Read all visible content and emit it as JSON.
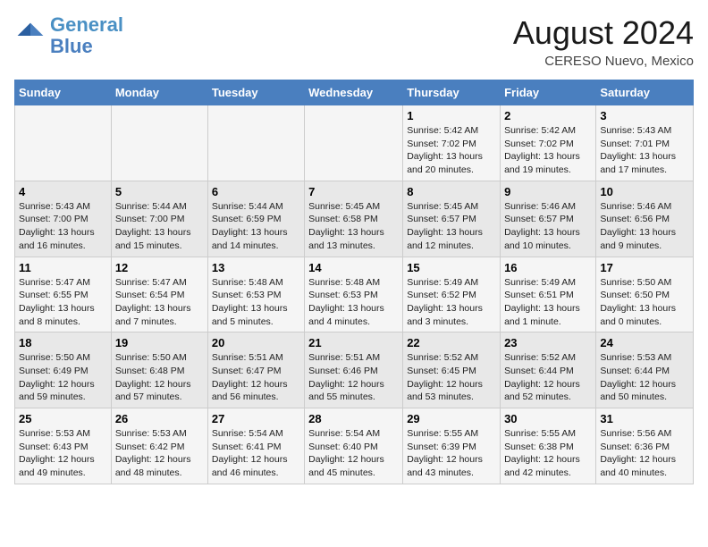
{
  "header": {
    "logo_line1": "General",
    "logo_line2": "Blue",
    "month_year": "August 2024",
    "location": "CERESO Nuevo, Mexico"
  },
  "days_of_week": [
    "Sunday",
    "Monday",
    "Tuesday",
    "Wednesday",
    "Thursday",
    "Friday",
    "Saturday"
  ],
  "weeks": [
    [
      {
        "day": "",
        "info": ""
      },
      {
        "day": "",
        "info": ""
      },
      {
        "day": "",
        "info": ""
      },
      {
        "day": "",
        "info": ""
      },
      {
        "day": "1",
        "info": "Sunrise: 5:42 AM\nSunset: 7:02 PM\nDaylight: 13 hours\nand 20 minutes."
      },
      {
        "day": "2",
        "info": "Sunrise: 5:42 AM\nSunset: 7:02 PM\nDaylight: 13 hours\nand 19 minutes."
      },
      {
        "day": "3",
        "info": "Sunrise: 5:43 AM\nSunset: 7:01 PM\nDaylight: 13 hours\nand 17 minutes."
      }
    ],
    [
      {
        "day": "4",
        "info": "Sunrise: 5:43 AM\nSunset: 7:00 PM\nDaylight: 13 hours\nand 16 minutes."
      },
      {
        "day": "5",
        "info": "Sunrise: 5:44 AM\nSunset: 7:00 PM\nDaylight: 13 hours\nand 15 minutes."
      },
      {
        "day": "6",
        "info": "Sunrise: 5:44 AM\nSunset: 6:59 PM\nDaylight: 13 hours\nand 14 minutes."
      },
      {
        "day": "7",
        "info": "Sunrise: 5:45 AM\nSunset: 6:58 PM\nDaylight: 13 hours\nand 13 minutes."
      },
      {
        "day": "8",
        "info": "Sunrise: 5:45 AM\nSunset: 6:57 PM\nDaylight: 13 hours\nand 12 minutes."
      },
      {
        "day": "9",
        "info": "Sunrise: 5:46 AM\nSunset: 6:57 PM\nDaylight: 13 hours\nand 10 minutes."
      },
      {
        "day": "10",
        "info": "Sunrise: 5:46 AM\nSunset: 6:56 PM\nDaylight: 13 hours\nand 9 minutes."
      }
    ],
    [
      {
        "day": "11",
        "info": "Sunrise: 5:47 AM\nSunset: 6:55 PM\nDaylight: 13 hours\nand 8 minutes."
      },
      {
        "day": "12",
        "info": "Sunrise: 5:47 AM\nSunset: 6:54 PM\nDaylight: 13 hours\nand 7 minutes."
      },
      {
        "day": "13",
        "info": "Sunrise: 5:48 AM\nSunset: 6:53 PM\nDaylight: 13 hours\nand 5 minutes."
      },
      {
        "day": "14",
        "info": "Sunrise: 5:48 AM\nSunset: 6:53 PM\nDaylight: 13 hours\nand 4 minutes."
      },
      {
        "day": "15",
        "info": "Sunrise: 5:49 AM\nSunset: 6:52 PM\nDaylight: 13 hours\nand 3 minutes."
      },
      {
        "day": "16",
        "info": "Sunrise: 5:49 AM\nSunset: 6:51 PM\nDaylight: 13 hours\nand 1 minute."
      },
      {
        "day": "17",
        "info": "Sunrise: 5:50 AM\nSunset: 6:50 PM\nDaylight: 13 hours\nand 0 minutes."
      }
    ],
    [
      {
        "day": "18",
        "info": "Sunrise: 5:50 AM\nSunset: 6:49 PM\nDaylight: 12 hours\nand 59 minutes."
      },
      {
        "day": "19",
        "info": "Sunrise: 5:50 AM\nSunset: 6:48 PM\nDaylight: 12 hours\nand 57 minutes."
      },
      {
        "day": "20",
        "info": "Sunrise: 5:51 AM\nSunset: 6:47 PM\nDaylight: 12 hours\nand 56 minutes."
      },
      {
        "day": "21",
        "info": "Sunrise: 5:51 AM\nSunset: 6:46 PM\nDaylight: 12 hours\nand 55 minutes."
      },
      {
        "day": "22",
        "info": "Sunrise: 5:52 AM\nSunset: 6:45 PM\nDaylight: 12 hours\nand 53 minutes."
      },
      {
        "day": "23",
        "info": "Sunrise: 5:52 AM\nSunset: 6:44 PM\nDaylight: 12 hours\nand 52 minutes."
      },
      {
        "day": "24",
        "info": "Sunrise: 5:53 AM\nSunset: 6:44 PM\nDaylight: 12 hours\nand 50 minutes."
      }
    ],
    [
      {
        "day": "25",
        "info": "Sunrise: 5:53 AM\nSunset: 6:43 PM\nDaylight: 12 hours\nand 49 minutes."
      },
      {
        "day": "26",
        "info": "Sunrise: 5:53 AM\nSunset: 6:42 PM\nDaylight: 12 hours\nand 48 minutes."
      },
      {
        "day": "27",
        "info": "Sunrise: 5:54 AM\nSunset: 6:41 PM\nDaylight: 12 hours\nand 46 minutes."
      },
      {
        "day": "28",
        "info": "Sunrise: 5:54 AM\nSunset: 6:40 PM\nDaylight: 12 hours\nand 45 minutes."
      },
      {
        "day": "29",
        "info": "Sunrise: 5:55 AM\nSunset: 6:39 PM\nDaylight: 12 hours\nand 43 minutes."
      },
      {
        "day": "30",
        "info": "Sunrise: 5:55 AM\nSunset: 6:38 PM\nDaylight: 12 hours\nand 42 minutes."
      },
      {
        "day": "31",
        "info": "Sunrise: 5:56 AM\nSunset: 6:36 PM\nDaylight: 12 hours\nand 40 minutes."
      }
    ]
  ]
}
